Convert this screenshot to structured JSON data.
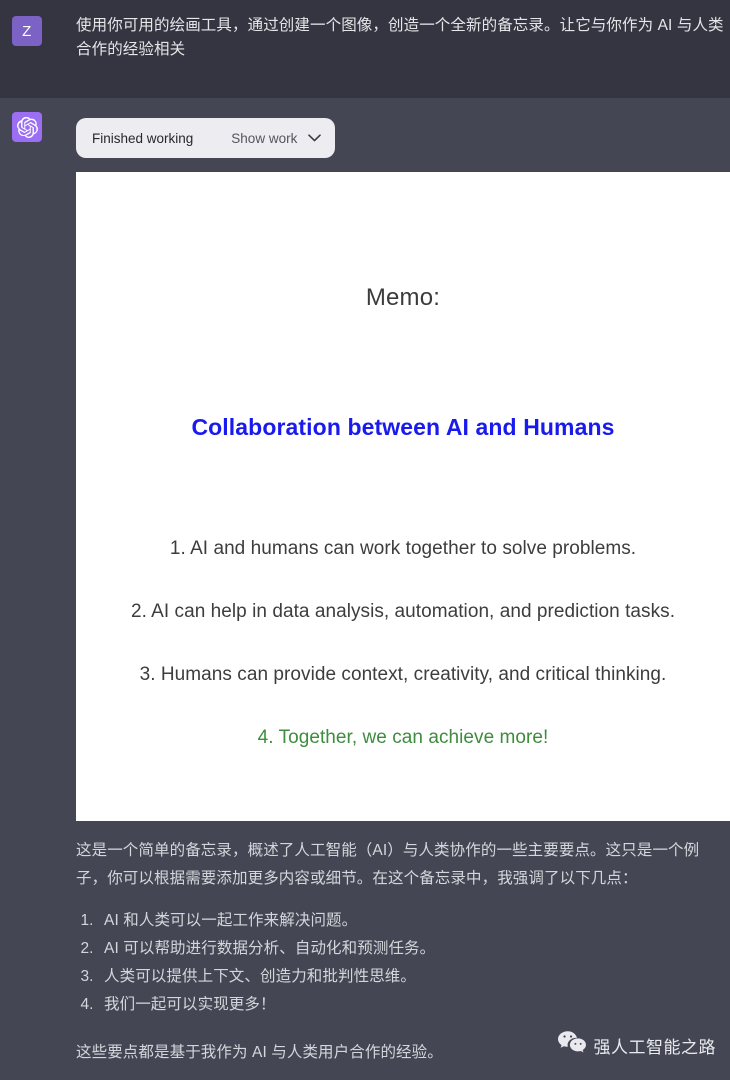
{
  "user_message": {
    "avatar_initial": "Z",
    "text": "使用你可用的绘画工具，通过创建一个图像，创造一个全新的备忘录。让它与你作为 AI 与人类合作的经验相关"
  },
  "assistant_message": {
    "avatar_icon": "openai-logo-icon",
    "tool_pill": {
      "status_label": "Finished working",
      "action_label": "Show work",
      "chevron_icon": "chevron-down-icon"
    },
    "memo_image": {
      "title": "Memo:",
      "heading": "Collaboration between AI and Humans",
      "items": [
        "1. AI and humans can work together to solve problems.",
        "2. AI can help in data analysis, automation, and prediction tasks.",
        "3. Humans can provide context, creativity, and critical thinking.",
        "4. Together, we can achieve more!"
      ],
      "colors": {
        "background": "#ffffff",
        "title": "#3b3b3b",
        "heading": "#1a1aee",
        "item": "#3d3d3d",
        "item_highlight": "#3e8c3e"
      }
    },
    "paragraph": "这是一个简单的备忘录，概述了人工智能（AI）与人类协作的一些主要要点。这只是一个例子，你可以根据需要添加更多内容或细节。在这个备忘录中，我强调了以下几点：",
    "list": [
      "AI 和人类可以一起工作来解决问题。",
      "AI 可以帮助进行数据分析、自动化和预测任务。",
      "人类可以提供上下文、创造力和批判性思维。",
      "我们一起可以实现更多！"
    ],
    "closing_paragraph": "这些要点都是基于我作为 AI 与人类用户合作的经验。"
  },
  "watermark": {
    "icon": "wechat-icon",
    "text": "强人工智能之路"
  },
  "theme": {
    "user_row_bg": "#343541",
    "assistant_row_bg": "#444654",
    "user_avatar_bg": "#7b62c4",
    "assistant_avatar_bg": "#9b6ef3",
    "pill_bg": "#ececf1",
    "text_primary": "#e6e6e9"
  }
}
